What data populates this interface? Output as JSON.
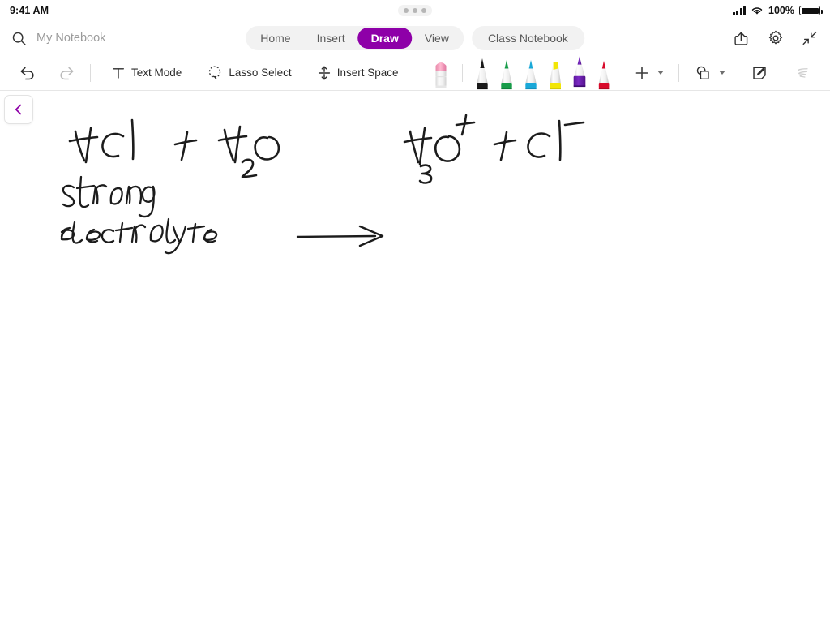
{
  "status_bar": {
    "time": "9:41 AM",
    "battery_percent": "100%",
    "signal_icon": "cellular-signal-icon",
    "wifi_icon": "wifi-icon",
    "battery_icon": "battery-full-icon",
    "multitask_handle_icon": "multitasking-dots-icon"
  },
  "top_bar": {
    "search_icon": "search-icon",
    "notebook_title": "My Notebook",
    "tabs": [
      {
        "label": "Home",
        "active": false
      },
      {
        "label": "Insert",
        "active": false
      },
      {
        "label": "Draw",
        "active": true
      },
      {
        "label": "View",
        "active": false
      }
    ],
    "class_notebook_tab": "Class Notebook",
    "actions": [
      {
        "name": "share-icon",
        "label": "Share"
      },
      {
        "name": "gear-icon",
        "label": "Settings"
      },
      {
        "name": "collapse-icon",
        "label": "Collapse Ribbon"
      }
    ],
    "active_accent": "#8e00a8"
  },
  "ribbon": {
    "undo": {
      "label": "Undo",
      "icon": "undo-icon",
      "enabled": true
    },
    "redo": {
      "label": "Redo",
      "icon": "redo-icon",
      "enabled": false
    },
    "tools": [
      {
        "label": "Text Mode",
        "icon": "text-mode-icon"
      },
      {
        "label": "Lasso Select",
        "icon": "lasso-select-icon"
      },
      {
        "label": "Insert Space",
        "icon": "insert-space-icon"
      }
    ],
    "eraser": {
      "label": "Eraser",
      "icon": "eraser-icon",
      "color": "#f2a0bd",
      "selected": false
    },
    "pens": [
      {
        "label": "Black Pen",
        "type": "pen",
        "color": "#1a1a1a",
        "selected": false
      },
      {
        "label": "Green Pen",
        "type": "pen",
        "color": "#179c49",
        "selected": false
      },
      {
        "label": "Blue Pen",
        "type": "pen",
        "color": "#19a8d8",
        "selected": false
      },
      {
        "label": "Yellow Highlighter",
        "type": "highlighter",
        "color": "#f2e606",
        "selected": false
      },
      {
        "label": "Purple Pen",
        "type": "pen",
        "color": "#6b20b0",
        "selected": true
      },
      {
        "label": "Red Pen",
        "type": "pen",
        "color": "#d80a2b",
        "selected": false
      }
    ],
    "add_pen": {
      "label": "Add Pen",
      "icon": "plus-icon",
      "chevron": "chevron-down-icon"
    },
    "shapes": {
      "label": "Shapes",
      "icon": "shapes-icon",
      "chevron": "chevron-down-icon"
    },
    "sticky_note": {
      "label": "Sticky Note",
      "icon": "note-edit-icon"
    },
    "ink_to_shape": {
      "label": "Ink Replay",
      "icon": "ink-scribble-icon",
      "enabled": false
    }
  },
  "canvas": {
    "sidebar_toggle": {
      "icon": "chevron-left-icon",
      "label": "Show Notebook Pane",
      "color": "#8e00a8"
    },
    "handwriting": {
      "ink_color": "#1c1c1c",
      "line_1": "HCl  +  H2O  ———>  H3O+  +  Cl-",
      "line_1_plain": "HCl + H2O -> H3O+ + Cl-",
      "line_2": "strong",
      "line_3": "electrolyte"
    }
  }
}
